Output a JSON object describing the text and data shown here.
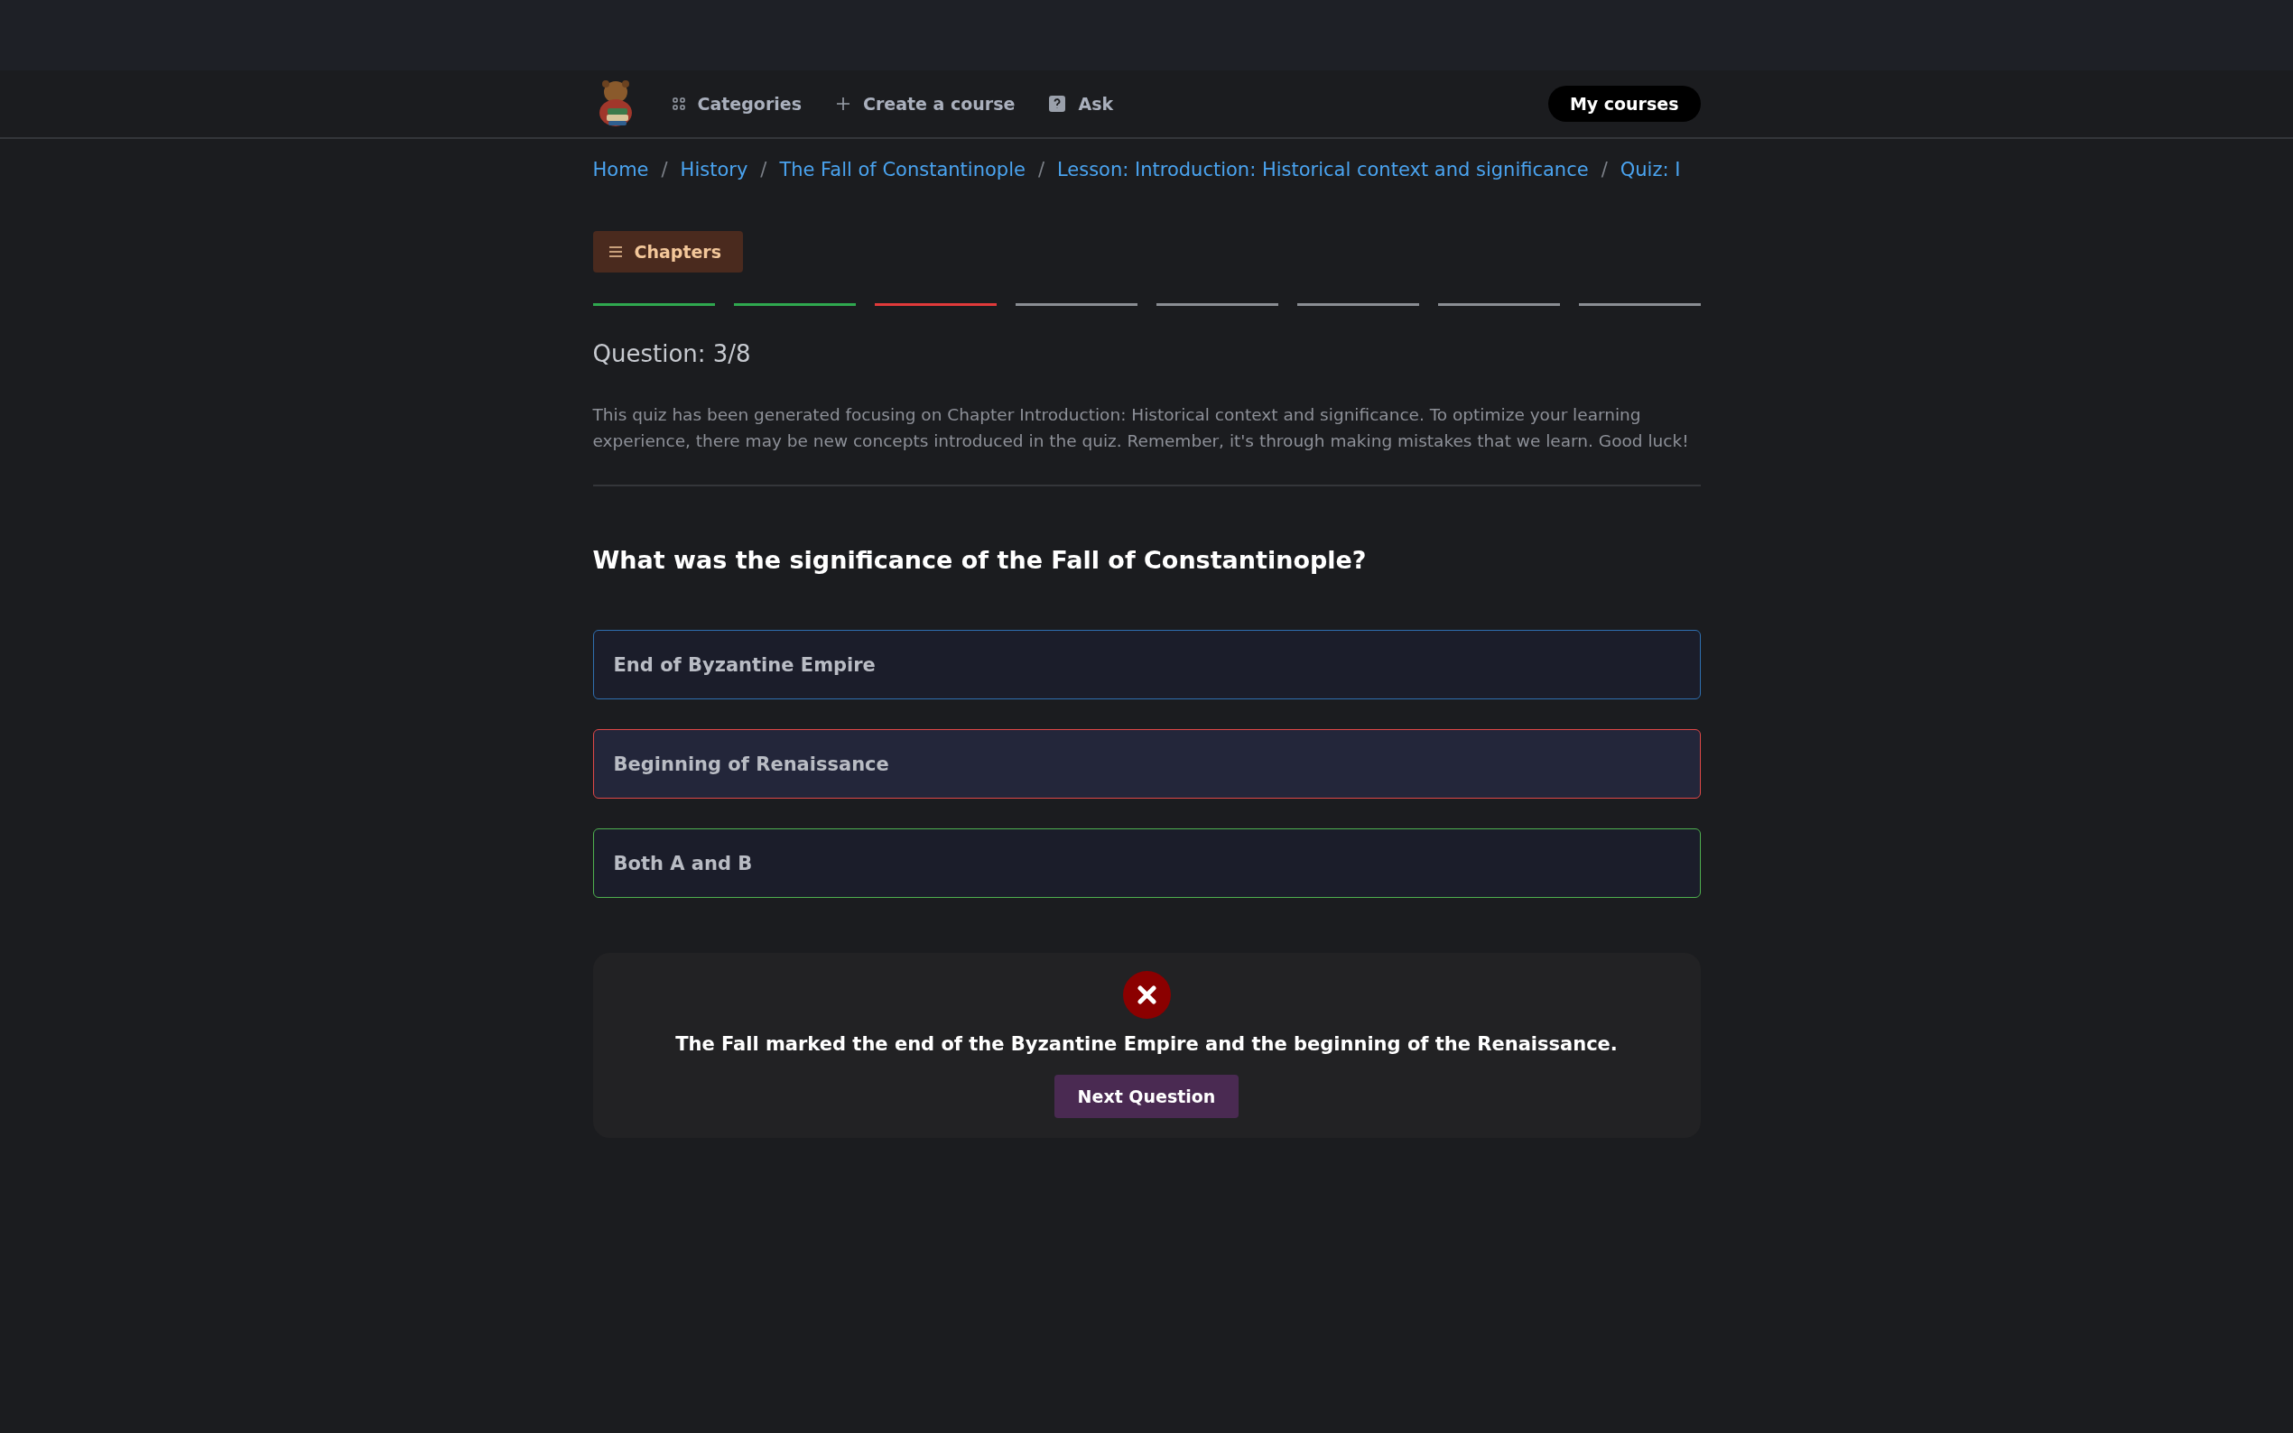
{
  "nav": {
    "items": [
      {
        "kind": "categories",
        "label": "Categories"
      },
      {
        "kind": "create",
        "label": "Create a course"
      },
      {
        "kind": "ask",
        "label": "Ask"
      }
    ],
    "my_courses": "My courses"
  },
  "breadcrumb": [
    "Home",
    "History",
    "The Fall of Constantinople",
    "Lesson: Introduction: Historical context and significance",
    "Quiz: I"
  ],
  "breadcrumb_separator": "/",
  "chapters_button": "Chapters",
  "progress": [
    {
      "answered": true,
      "correct": true
    },
    {
      "answered": true,
      "correct": true
    },
    {
      "answered": true,
      "correct": false
    },
    {
      "answered": false
    },
    {
      "answered": false
    },
    {
      "answered": false
    },
    {
      "answered": false
    },
    {
      "answered": false
    }
  ],
  "question_label": "Question: 3/8",
  "intro": "This quiz has been generated focusing on Chapter Introduction: Historical context and significance. To optimize your learning experience, there may be new concepts introduced in the quiz. Remember, it's through making mistakes that we learn. Good luck!",
  "question": "What was the significance of the Fall of Constantinople?",
  "options": [
    {
      "label": "End of Byzantine Empire",
      "selected": false,
      "correct": false
    },
    {
      "label": "Beginning of Renaissance",
      "selected": true,
      "correct": false
    },
    {
      "label": "Both A and B",
      "selected": false,
      "correct": true
    }
  ],
  "feedback": {
    "correct": false,
    "explanation": "The Fall marked the end of the Byzantine Empire and the beginning of the Renaissance.",
    "next_button": "Next Question"
  }
}
